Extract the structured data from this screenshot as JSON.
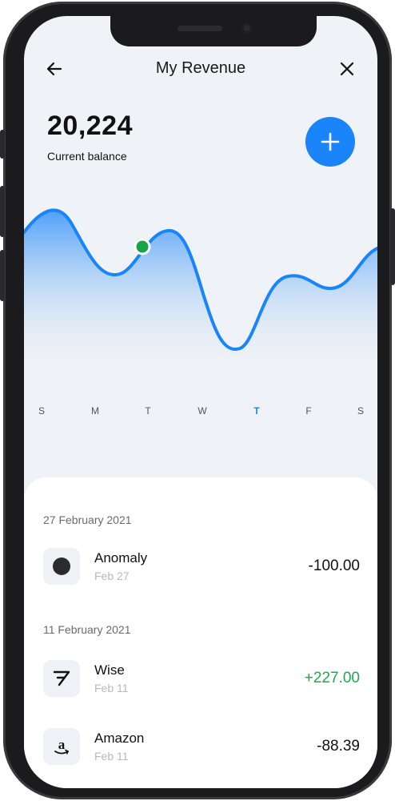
{
  "header": {
    "title": "My Revenue",
    "back_icon": "arrow-left-icon",
    "close_icon": "close-icon"
  },
  "balance": {
    "amount": "20,224",
    "label": "Current balance"
  },
  "add_button_icon": "plus-icon",
  "chart_data": {
    "type": "area",
    "x": [
      "S",
      "M",
      "T",
      "W",
      "T",
      "F",
      "S"
    ],
    "highlighted_point": "T",
    "selected_day": "T",
    "line_color": "#1a84fb",
    "marker_color": "#16a34a"
  },
  "days": [
    {
      "label": "S",
      "active": false
    },
    {
      "label": "M",
      "active": false
    },
    {
      "label": "T",
      "active": false
    },
    {
      "label": "W",
      "active": false
    },
    {
      "label": "T",
      "active": true
    },
    {
      "label": "F",
      "active": false
    },
    {
      "label": "S",
      "active": false
    }
  ],
  "transactions": {
    "groups": [
      {
        "date": "27 February 2021",
        "items": [
          {
            "name": "Anomaly",
            "date": "Feb 27",
            "amount": "-100.00",
            "icon": "circle-logo-icon",
            "positive": false
          }
        ]
      },
      {
        "date": "11 February 2021",
        "items": [
          {
            "name": "Wise",
            "date": "Feb 11",
            "amount": "+227.00",
            "icon": "wise-logo-icon",
            "positive": true
          },
          {
            "name": "Amazon",
            "date": "Feb 11",
            "amount": "-88.39",
            "icon": "amazon-logo-icon",
            "positive": false
          }
        ]
      }
    ]
  },
  "colors": {
    "accent": "#1a84fb",
    "positive": "#1ea94f",
    "background": "#eff2f6"
  }
}
